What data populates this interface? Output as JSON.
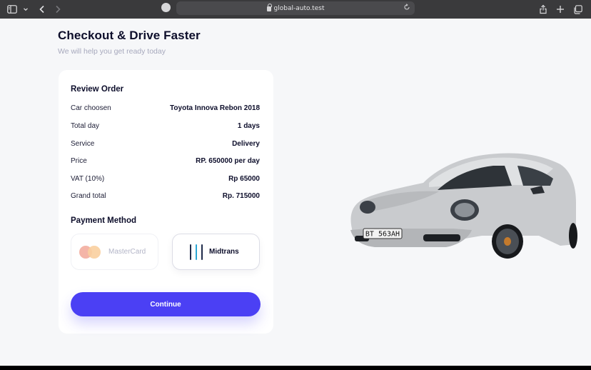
{
  "browser": {
    "url": "global-auto.test"
  },
  "page": {
    "title": "Checkout & Drive Faster",
    "subtitle": "We will help you get ready today"
  },
  "review": {
    "heading": "Review Order",
    "rows": [
      {
        "label": "Car choosen",
        "value": "Toyota Innova Rebon 2018"
      },
      {
        "label": "Total day",
        "value": "1 days"
      },
      {
        "label": "Service",
        "value": "Delivery"
      },
      {
        "label": "Price",
        "value": "RP. 650000 per day"
      },
      {
        "label": "VAT (10%)",
        "value": "Rp 65000"
      },
      {
        "label": "Grand total",
        "value": "Rp. 715000"
      }
    ]
  },
  "payment": {
    "heading": "Payment Method",
    "methods": [
      {
        "label": "MasterCard",
        "selected": false
      },
      {
        "label": "Midtrans",
        "selected": true
      }
    ]
  },
  "actions": {
    "continue_label": "Continue"
  },
  "car_image": {
    "plate": "BT 563AH"
  },
  "colors": {
    "primary": "#4b40f4",
    "heading": "#0d0e2b",
    "muted": "#a7a9bd",
    "background": "#f6f7f9",
    "card": "#ffffff"
  },
  "icons": [
    "sidebar-icon",
    "chevron-down-icon",
    "back-icon",
    "forward-icon",
    "lock-icon",
    "reload-icon",
    "share-icon",
    "new-tab-icon",
    "tabs-icon"
  ]
}
